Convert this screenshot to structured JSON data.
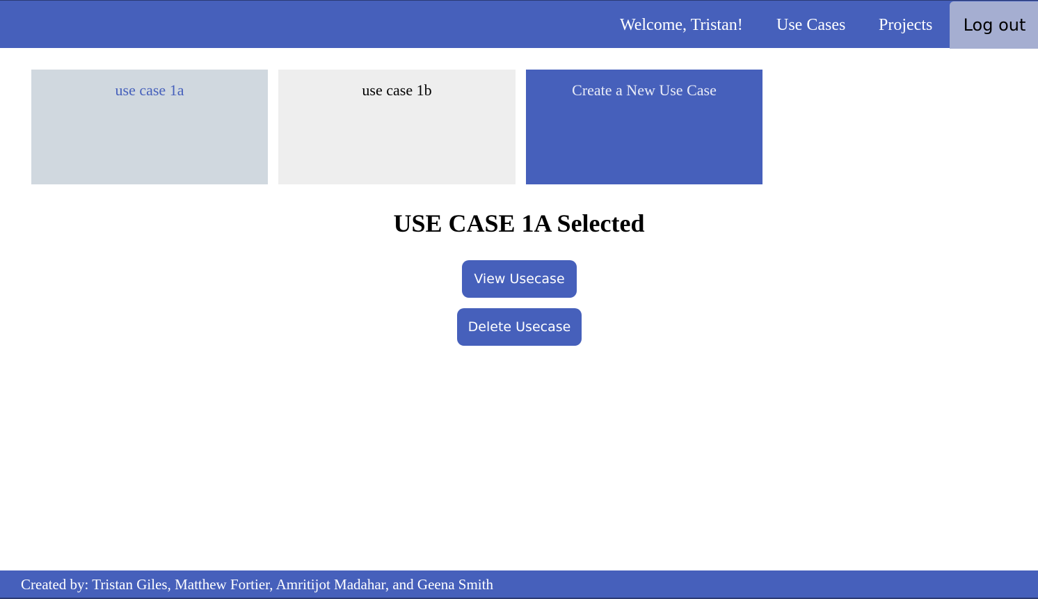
{
  "navbar": {
    "welcome_text": "Welcome, Tristan!",
    "links": [
      {
        "label": "Use Cases"
      },
      {
        "label": "Projects"
      }
    ],
    "logout_label": "Log out"
  },
  "cards": [
    {
      "label": "use case 1a",
      "state": "selected"
    },
    {
      "label": "use case 1b",
      "state": "default"
    },
    {
      "label": "Create a New Use Case",
      "state": "create"
    }
  ],
  "selection": {
    "title": "USE CASE 1A Selected",
    "view_button_label": "View Usecase",
    "delete_button_label": "Delete Usecase"
  },
  "footer": {
    "text": "Created by: Tristan Giles, Matthew Fortier, Amritijot Madahar, and Geena Smith"
  },
  "colors": {
    "primary": "#4660bb",
    "selected_card": "#d0d8df",
    "default_card": "#eeeeee",
    "logout_bg": "#a5aed1"
  }
}
